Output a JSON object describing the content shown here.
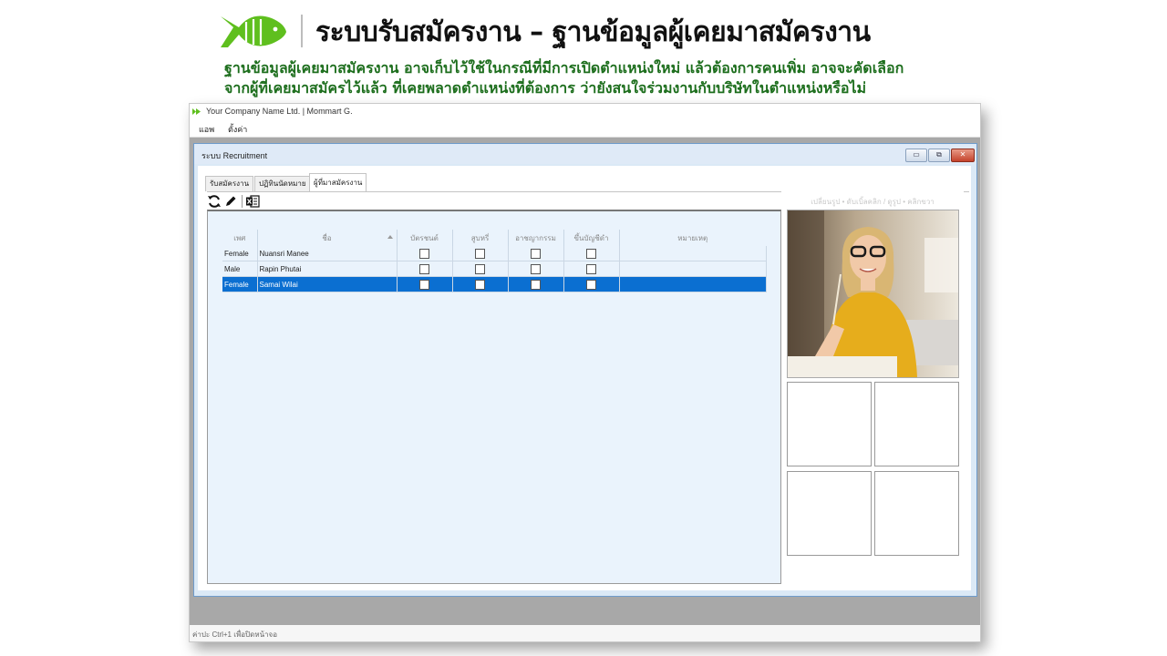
{
  "header": {
    "title": "ระบบรับสมัครงาน – ฐานข้อมูลผู้เคยมาสมัครงาน",
    "desc_line1": "ฐานข้อมูลผู้เคยมาสมัครงาน อาจเก็บไว้ใช้ในกรณีที่มีการเปิดตำแหน่งใหม่ แล้วต้องการคนเพิ่ม อาจจะคัดเลือก",
    "desc_line2": "จากผู้ที่เคยมาสมัครไว้แล้ว ที่เคยพลาดตำแหน่งที่ต้องการ ว่ายังสนใจร่วมงานกับบริษัทในตำแหน่งหรือไม่",
    "logo_color": "#5fbf1e"
  },
  "app": {
    "title": "Your Company Name Ltd. | Mommart G.",
    "menu": [
      "แอพ",
      "ตั้งค่า"
    ],
    "status": "ค่าปะ Ctrl+1 เพื่อปิดหน้าจอ"
  },
  "window": {
    "title": "ระบบ Recruitment",
    "buttons": [
      "▭",
      "⧉",
      "✕"
    ]
  },
  "tabs": [
    "รับสมัครงาน",
    "ปฏิทินนัดหมาย",
    "ผู้ที่มาสมัครงาน"
  ],
  "active_tab": 2,
  "grid": {
    "columns": [
      "เพศ",
      "ชื่อ",
      "บัตรชนต์",
      "สูบหรี่",
      "อาชญากรรม",
      "ขึ้นบัญชีดำ",
      "หมายเหตุ"
    ],
    "rows": [
      {
        "gender": "Female",
        "name": "Nuansri Manee"
      },
      {
        "gender": "Male",
        "name": "Rapin Phutai"
      },
      {
        "gender": "Female",
        "name": "Samai Wilai"
      }
    ],
    "selected_row": 2,
    "selection_color": "#0b6fd1"
  },
  "photo_panel": {
    "hint": "เปลี่ยนรูป • ดับเบิ้ลคลิก / ดูรูป • คลิกขวา"
  }
}
